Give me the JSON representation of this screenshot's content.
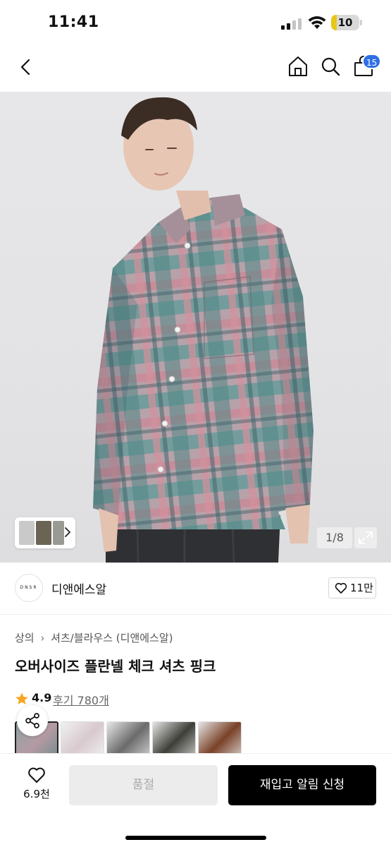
{
  "status_bar": {
    "time": "11:41",
    "battery": "10"
  },
  "header": {
    "cart_count": "15",
    "icons": [
      "back-icon",
      "home-icon",
      "search-icon",
      "shopping-bag-icon"
    ]
  },
  "gallery": {
    "counter": "1/8",
    "icons": [
      "expand-icon",
      "chevron-right-icon"
    ],
    "colors": {
      "background": "#e5e5e7",
      "shirt_pink": "#c98a96",
      "shirt_teal": "#5e9a97"
    }
  },
  "brand": {
    "logo_text": "DNSR",
    "name": "디앤에스알",
    "likes": "11만"
  },
  "product": {
    "breadcrumb": [
      "상의",
      "셔츠/블라우스 (디앤에스알)"
    ],
    "title": "오버사이즈 플란넬 체크 셔츠 핑크",
    "rating": "4.9",
    "reviews": "후기 780개"
  },
  "bottom_bar": {
    "wish_count": "6.9천",
    "soldout_label": "품절",
    "restock_label": "재입고 알림 신청",
    "colors": {
      "primary": "#000000",
      "disabled": "#ececec"
    }
  }
}
